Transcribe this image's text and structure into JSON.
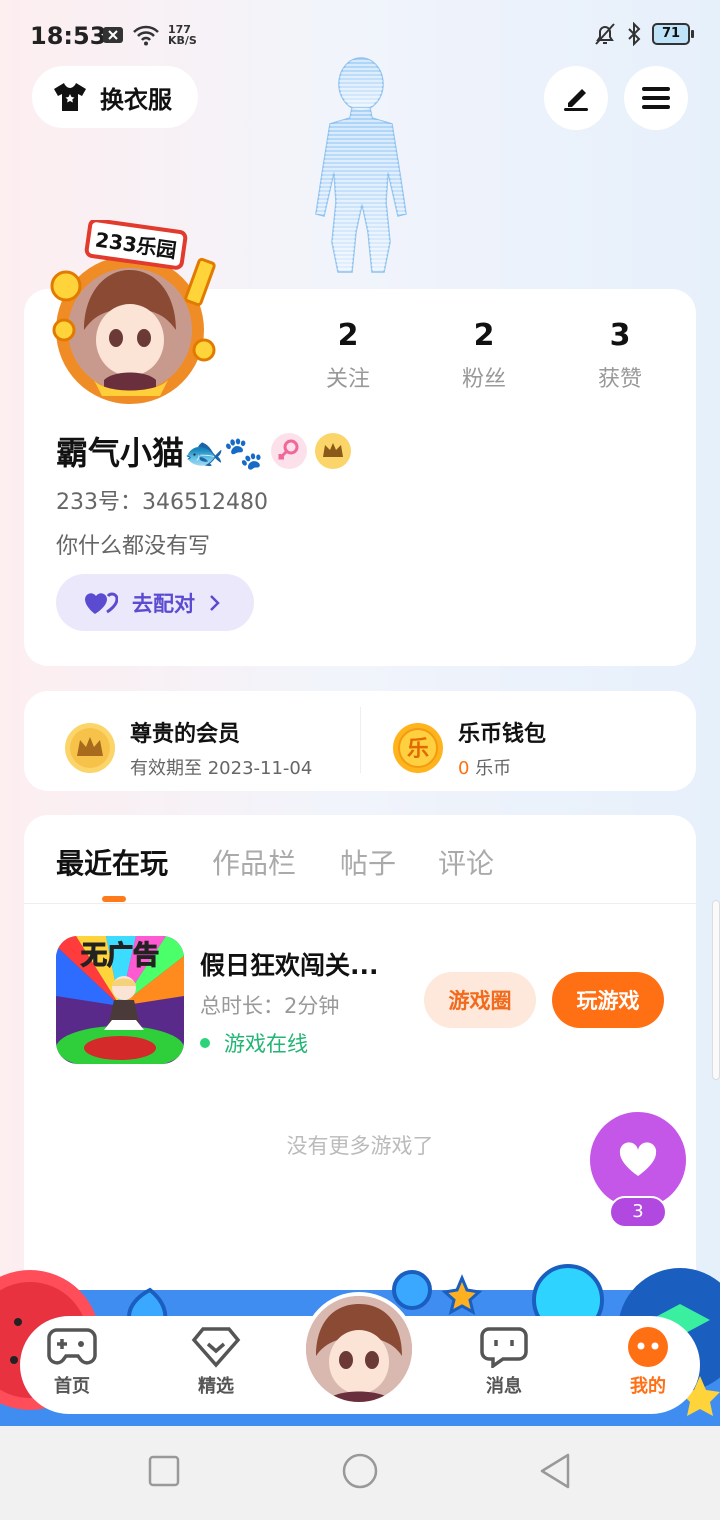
{
  "status_bar": {
    "time": "18:53",
    "net_speed_value": "177",
    "net_speed_unit": "KB/S",
    "battery": "71"
  },
  "header": {
    "outfit_label": "换衣服"
  },
  "profile": {
    "avatar_badge": "233乐园",
    "stats": [
      {
        "value": "2",
        "label": "关注"
      },
      {
        "value": "2",
        "label": "粉丝"
      },
      {
        "value": "3",
        "label": "获赞"
      }
    ],
    "nickname": "霸气小猫🐟🐾",
    "uid_label": "233号：",
    "uid": "346512480",
    "bio": "你什么都没有写",
    "pair_label": "去配对"
  },
  "membership": {
    "title": "尊贵的会员",
    "subtitle": "有效期至 2023-11-04"
  },
  "wallet": {
    "title": "乐币钱包",
    "amount": "0",
    "unit": "乐币",
    "coin_char": "乐"
  },
  "tabs": [
    "最近在玩",
    "作品栏",
    "帖子",
    "评论"
  ],
  "recent_game": {
    "icon_text": "无广告",
    "title": "假日狂欢闯关...",
    "duration": "总时长：2分钟",
    "status": "游戏在线",
    "circle_label": "游戏圈",
    "play_label": "玩游戏"
  },
  "empty_hint": "没有更多游戏了",
  "like_count": "3",
  "bottom_nav": [
    {
      "label": "首页"
    },
    {
      "label": "精选"
    },
    {
      "label": "消息"
    },
    {
      "label": "我的"
    }
  ],
  "colors": {
    "accent": "#ff6f14",
    "like": "#c457e8",
    "pair": "#5a4bd1",
    "online": "#22b573"
  }
}
